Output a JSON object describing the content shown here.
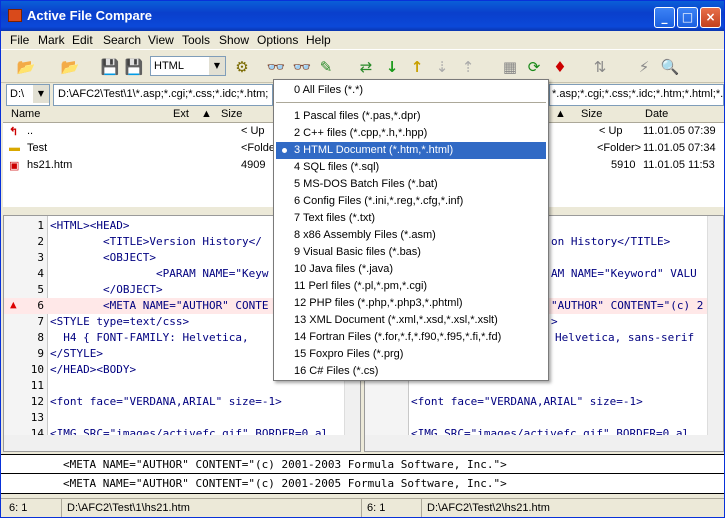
{
  "window": {
    "title": "Active File Compare"
  },
  "menubar": [
    "File",
    "Mark",
    "Edit",
    "Search",
    "View",
    "Tools",
    "Show",
    "Options",
    "Help"
  ],
  "toolbar": {
    "syntax_value": "HTML"
  },
  "left": {
    "drive": "D:\\",
    "path": "D:\\AFC2\\Test\\1\\*.asp;*.cgi;*.css;*.idc;*.htm;",
    "columns": [
      "Name",
      "Ext",
      "Size"
    ],
    "files": [
      {
        "name": "..",
        "size": "< Up"
      },
      {
        "name": "Test",
        "size": "<Folder>"
      },
      {
        "name": "hs21.htm",
        "size": "4909"
      }
    ],
    "lines": [
      {
        "n": "1",
        "c": "<HTML><HEAD>"
      },
      {
        "n": "2",
        "c": "        <TITLE>Version History</"
      },
      {
        "n": "3",
        "c": "        <OBJECT>"
      },
      {
        "n": "4",
        "c": "                <PARAM NAME=\"Keyw"
      },
      {
        "n": "5",
        "c": "        </OBJECT>"
      },
      {
        "n": "6",
        "c": "        <META NAME=\"AUTHOR\" CONTE"
      },
      {
        "n": "7",
        "c": "<STYLE type=text/css>"
      },
      {
        "n": "8",
        "c": "  H4 { FONT-FAMILY: Helvetica,"
      },
      {
        "n": "9",
        "c": "</STYLE>"
      },
      {
        "n": "10",
        "c": "</HEAD><BODY>"
      },
      {
        "n": "11",
        "c": ""
      },
      {
        "n": "12",
        "c": "<font face=\"VERDANA,ARIAL\" size=-1>"
      },
      {
        "n": "13",
        "c": ""
      },
      {
        "n": "14",
        "c": "<IMG SRC=\"images/activefc.gif\" BORDER=0 al"
      }
    ],
    "status_pos": "6: 1",
    "status_path": "D:\\AFC2\\Test\\1\\hs21.htm"
  },
  "right": {
    "path": "*.asp;*.cgi;*.css;*.idc;*.htm;*.html;*.shtm;*.shtml",
    "columns": [
      "Size",
      "Date"
    ],
    "files": [
      {
        "size": "< Up",
        "date": "11.01.05 07:39"
      },
      {
        "size": "<Folder>",
        "date": "11.01.05 07:34"
      },
      {
        "size": "5910",
        "date": "11.01.05 11:53"
      }
    ],
    "lines": [
      {
        "c": "on History</TITLE>"
      },
      {
        "c": ""
      },
      {
        "c": "AM NAME=\"Keyword\" VALU"
      },
      {
        "c": ""
      },
      {
        "c": "\"AUTHOR\" CONTENT=\"(c) 2"
      },
      {
        "c": ">"
      },
      {
        "c": "Helvetica, sans-serif"
      },
      {
        "c": ""
      },
      {
        "c": ""
      },
      {
        "c": ""
      },
      {
        "c": "<font face=\"VERDANA,ARIAL\" size=-1>"
      },
      {
        "c": ""
      },
      {
        "c": "<IMG SRC=\"images/activefc.gif\" BORDER=0 al"
      }
    ],
    "status_pos": "6: 1",
    "status_path": "D:\\AFC2\\Test\\2\\hs21.htm"
  },
  "compare": {
    "line1": "<META NAME=\"AUTHOR\" CONTENT=\"(c) 2001-2003 Formula Software, Inc.\">",
    "line2": "<META NAME=\"AUTHOR\" CONTENT=\"(c) 2001-2005 Formula Software, Inc.\">"
  },
  "filter_menu": {
    "items": [
      "0 All Files (*.*)",
      "1 Pascal files (*.pas,*.dpr)",
      "2 C++ files (*.cpp,*.h,*.hpp)",
      "3 HTML Document (*.htm,*.html)",
      "4 SQL files (*.sql)",
      "5 MS-DOS Batch Files (*.bat)",
      "6 Config Files (*.ini,*.reg,*.cfg,*.inf)",
      "7 Text files (*.txt)",
      "8 x86 Assembly Files (*.asm)",
      "9 Visual Basic files (*.bas)",
      "10 Java files (*.java)",
      "11 Perl files (*.pl,*.pm,*.cgi)",
      "12 PHP files (*.php,*.php3,*.phtml)",
      "13 XML Document (*.xml,*.xsd,*.xsl,*.xslt)",
      "14 Fortran Files (*.for,*.f,*.f90,*.f95,*.fi,*.fd)",
      "15 Foxpro Files (*.prg)",
      "16 C# Files (*.cs)"
    ],
    "selected_index": 3
  }
}
